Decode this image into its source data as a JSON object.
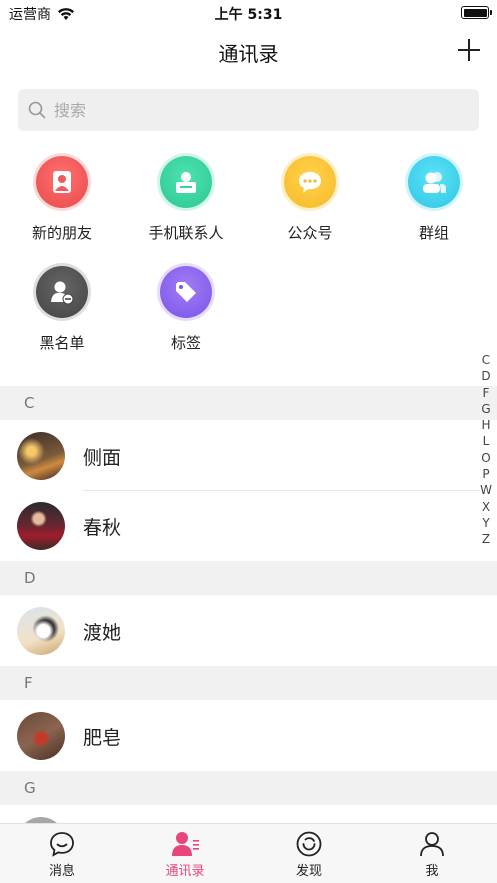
{
  "status_bar": {
    "carrier": "运营商",
    "time": "上午 5:31"
  },
  "header": {
    "title": "通讯录"
  },
  "search": {
    "placeholder": "搜索"
  },
  "functions": [
    {
      "label": "新的朋友",
      "icon": "new-friend-icon",
      "color": "#ef5b5b"
    },
    {
      "label": "手机联系人",
      "icon": "phone-contacts-icon",
      "color": "#38d39f"
    },
    {
      "label": "公众号",
      "icon": "official-account-icon",
      "color": "#fbc53a"
    },
    {
      "label": "群组",
      "icon": "group-icon",
      "color": "#40d3ee"
    },
    {
      "label": "黑名单",
      "icon": "blacklist-icon",
      "color": "#555555"
    },
    {
      "label": "标签",
      "icon": "tag-icon",
      "color": "#8b63ef"
    }
  ],
  "index_letters": [
    "C",
    "D",
    "F",
    "G",
    "H",
    "L",
    "O",
    "P",
    "W",
    "X",
    "Y",
    "Z"
  ],
  "contacts": {
    "sections": [
      {
        "letter": "C",
        "names": [
          "侧面",
          "春秋"
        ]
      },
      {
        "letter": "D",
        "names": [
          "渡她"
        ]
      },
      {
        "letter": "F",
        "names": [
          "肥皂"
        ]
      },
      {
        "letter": "G",
        "names": []
      }
    ]
  },
  "tab_bar": {
    "tabs": [
      {
        "label": "消息",
        "icon": "chat-icon"
      },
      {
        "label": "通讯录",
        "icon": "contacts-icon",
        "active": true
      },
      {
        "label": "发现",
        "icon": "discover-icon"
      },
      {
        "label": "我",
        "icon": "profile-icon"
      }
    ]
  },
  "colors": {
    "accent": "#e8457a",
    "section_bg": "#f1f1f1",
    "search_bg": "#efefef"
  }
}
